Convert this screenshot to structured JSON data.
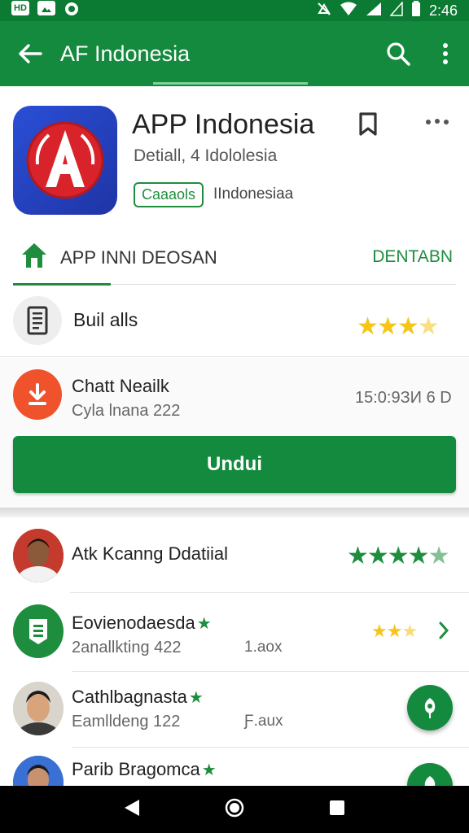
{
  "status_bar": {
    "time": "2:46",
    "left_icons": [
      "hd-icon",
      "image-icon",
      "sync-icon"
    ],
    "right_icons": [
      "mute-icon",
      "wifi-icon",
      "signal-icon",
      "battery-icon"
    ]
  },
  "app_bar": {
    "title": "AF Indonesia",
    "back_icon": "back-arrow-icon",
    "search_icon": "search-icon",
    "menu_icon": "more-vert-icon"
  },
  "app": {
    "name": "APP Indonesia",
    "subtitle": "Detiall, 4 Idololesia",
    "badge": "Caaaols",
    "badge_text": "IIndonesiaa"
  },
  "tab_row": {
    "label": "APP INNI DEOSAN",
    "right_action": "DENTABN"
  },
  "builds": {
    "label": "Buil alls",
    "rating": 3.5
  },
  "download": {
    "title": "Chatt Neailk",
    "subtitle": "Cyla lnana 222",
    "size": "15:0:9ЗИ 6 D",
    "install_label": "Undui"
  },
  "list": [
    {
      "name": "Atk Kcanng Ddatiial",
      "sub": "",
      "meta": "",
      "rating": 4.5,
      "star_color": "#1e8e3e",
      "avatar": "person",
      "verified": false
    },
    {
      "name": "Eovienodaesda",
      "sub": "2anallkting 422",
      "meta": "1.aox",
      "rating": 2.5,
      "star_color": "#f5c518",
      "avatar": "badge",
      "verified": true
    },
    {
      "name": "Cathlbagnasta",
      "sub": "Eamlldeng 122",
      "meta": "Ƒ.aux",
      "rating": null,
      "star_color": "",
      "avatar": "person",
      "verified": true
    },
    {
      "name": "Parib Bragomca",
      "sub": "",
      "meta": "",
      "rating": null,
      "star_color": "",
      "avatar": "person",
      "verified": true
    }
  ],
  "nav_bar": {
    "icons": [
      "nav-back-icon",
      "nav-home-icon",
      "nav-recents-icon"
    ]
  },
  "colors": {
    "primary": "#138a3e",
    "status": "#0b7a32",
    "accent": "#1e8e3e",
    "star": "#f5c518",
    "orange": "#f0522b"
  }
}
